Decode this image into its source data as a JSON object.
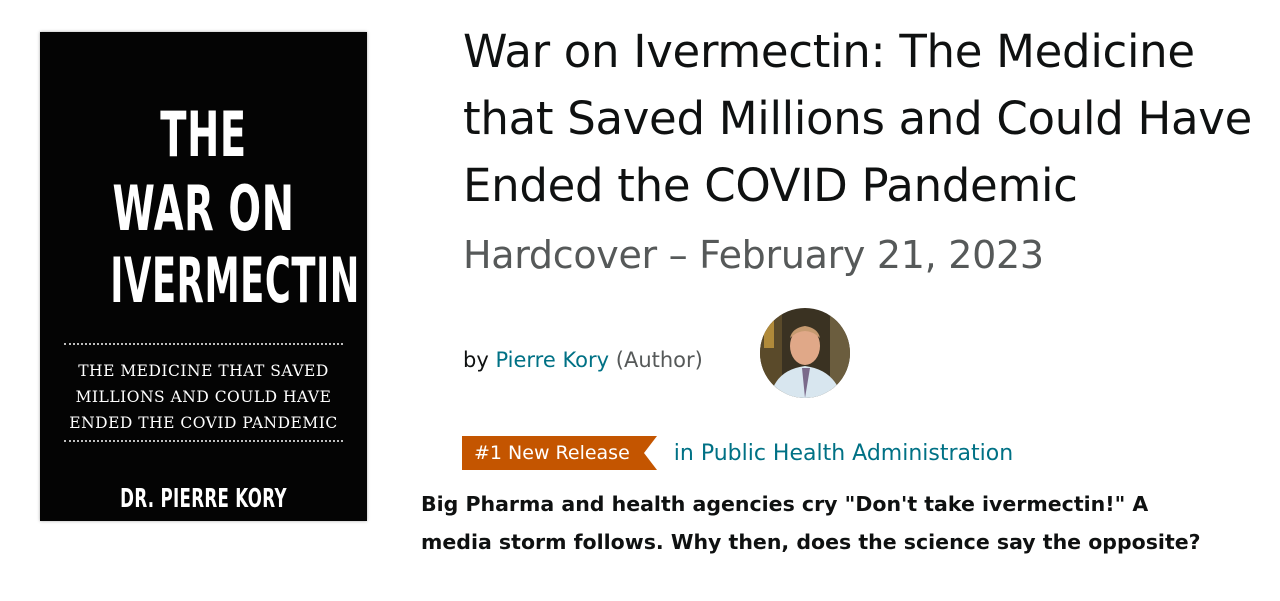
{
  "cover": {
    "title_line1": "THE",
    "title_line2": "WAR ON",
    "title_line3": "IVERMECTIN",
    "subtitle_line1": "THE MEDICINE THAT SAVED",
    "subtitle_line2": "MILLIONS AND COULD HAVE",
    "subtitle_line3": "ENDED THE COVID PANDEMIC",
    "author": "DR. PIERRE KORY"
  },
  "product": {
    "title": "War on Ivermectin: The Medicine that Saved Millions and Could Have Ended the COVID Pandemic",
    "format": "Hardcover – February 21, 2023",
    "by": "by",
    "author_name": "Pierre Kory",
    "author_role": "(Author)",
    "badge": "#1 New Release",
    "category": "in Public Health Administration",
    "description": "Big Pharma and health agencies cry \"Don't take ivermectin!\" A media storm follows. Why then, does the science say the opposite?"
  },
  "colors": {
    "link": "#007185",
    "badge": "#c45500",
    "muted": "#565959"
  },
  "icons": {
    "author_photo": "author-avatar"
  }
}
